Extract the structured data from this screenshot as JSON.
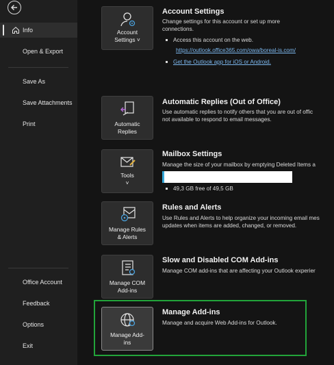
{
  "sidebar": {
    "items": [
      {
        "label": "Info",
        "active": true
      },
      {
        "label": "Open & Export"
      },
      {
        "label": "Save As"
      },
      {
        "label": "Save Attachments"
      },
      {
        "label": "Print"
      },
      {
        "label": "Office Account"
      },
      {
        "label": "Feedback"
      },
      {
        "label": "Options"
      },
      {
        "label": "Exit"
      }
    ]
  },
  "sections": [
    {
      "button": "Account\nSettings ˅",
      "title": "Account Settings",
      "desc": "Change settings for this account or set up more\nconnections.",
      "bullet1": "Access this account on the web.",
      "link1": "https://outlook.office365.com/owa/boreal-is.com/",
      "link2": "Get the Outlook app for iOS or Android."
    },
    {
      "button": "Automatic\nReplies",
      "title": "Automatic Replies (Out of Office)",
      "desc": "Use automatic replies to notify others that you are out of offic\nnot available to respond to email messages."
    },
    {
      "button": "Tools\n˅",
      "title": "Mailbox Settings",
      "desc": "Manage the size of your mailbox by emptying Deleted Items a",
      "storage": "49,3 GB free of 49,5 GB",
      "used_fraction": 0.004
    },
    {
      "button": "Manage Rules\n& Alerts",
      "title": "Rules and Alerts",
      "desc": "Use Rules and Alerts to help organize your incoming email mes\nupdates when items are added, changed, or removed."
    },
    {
      "button": "Manage COM\nAdd-ins",
      "title": "Slow and Disabled COM Add-ins",
      "desc": "Manage COM add-ins that are affecting your Outlook experier"
    },
    {
      "button": "Manage Add-\nins",
      "title": "Manage Add-ins",
      "desc": "Manage and acquire Web Add-ins for Outlook."
    }
  ],
  "colors": {
    "highlight": "#22a43a",
    "link": "#7db9f0",
    "progress": "#33a7d8"
  }
}
